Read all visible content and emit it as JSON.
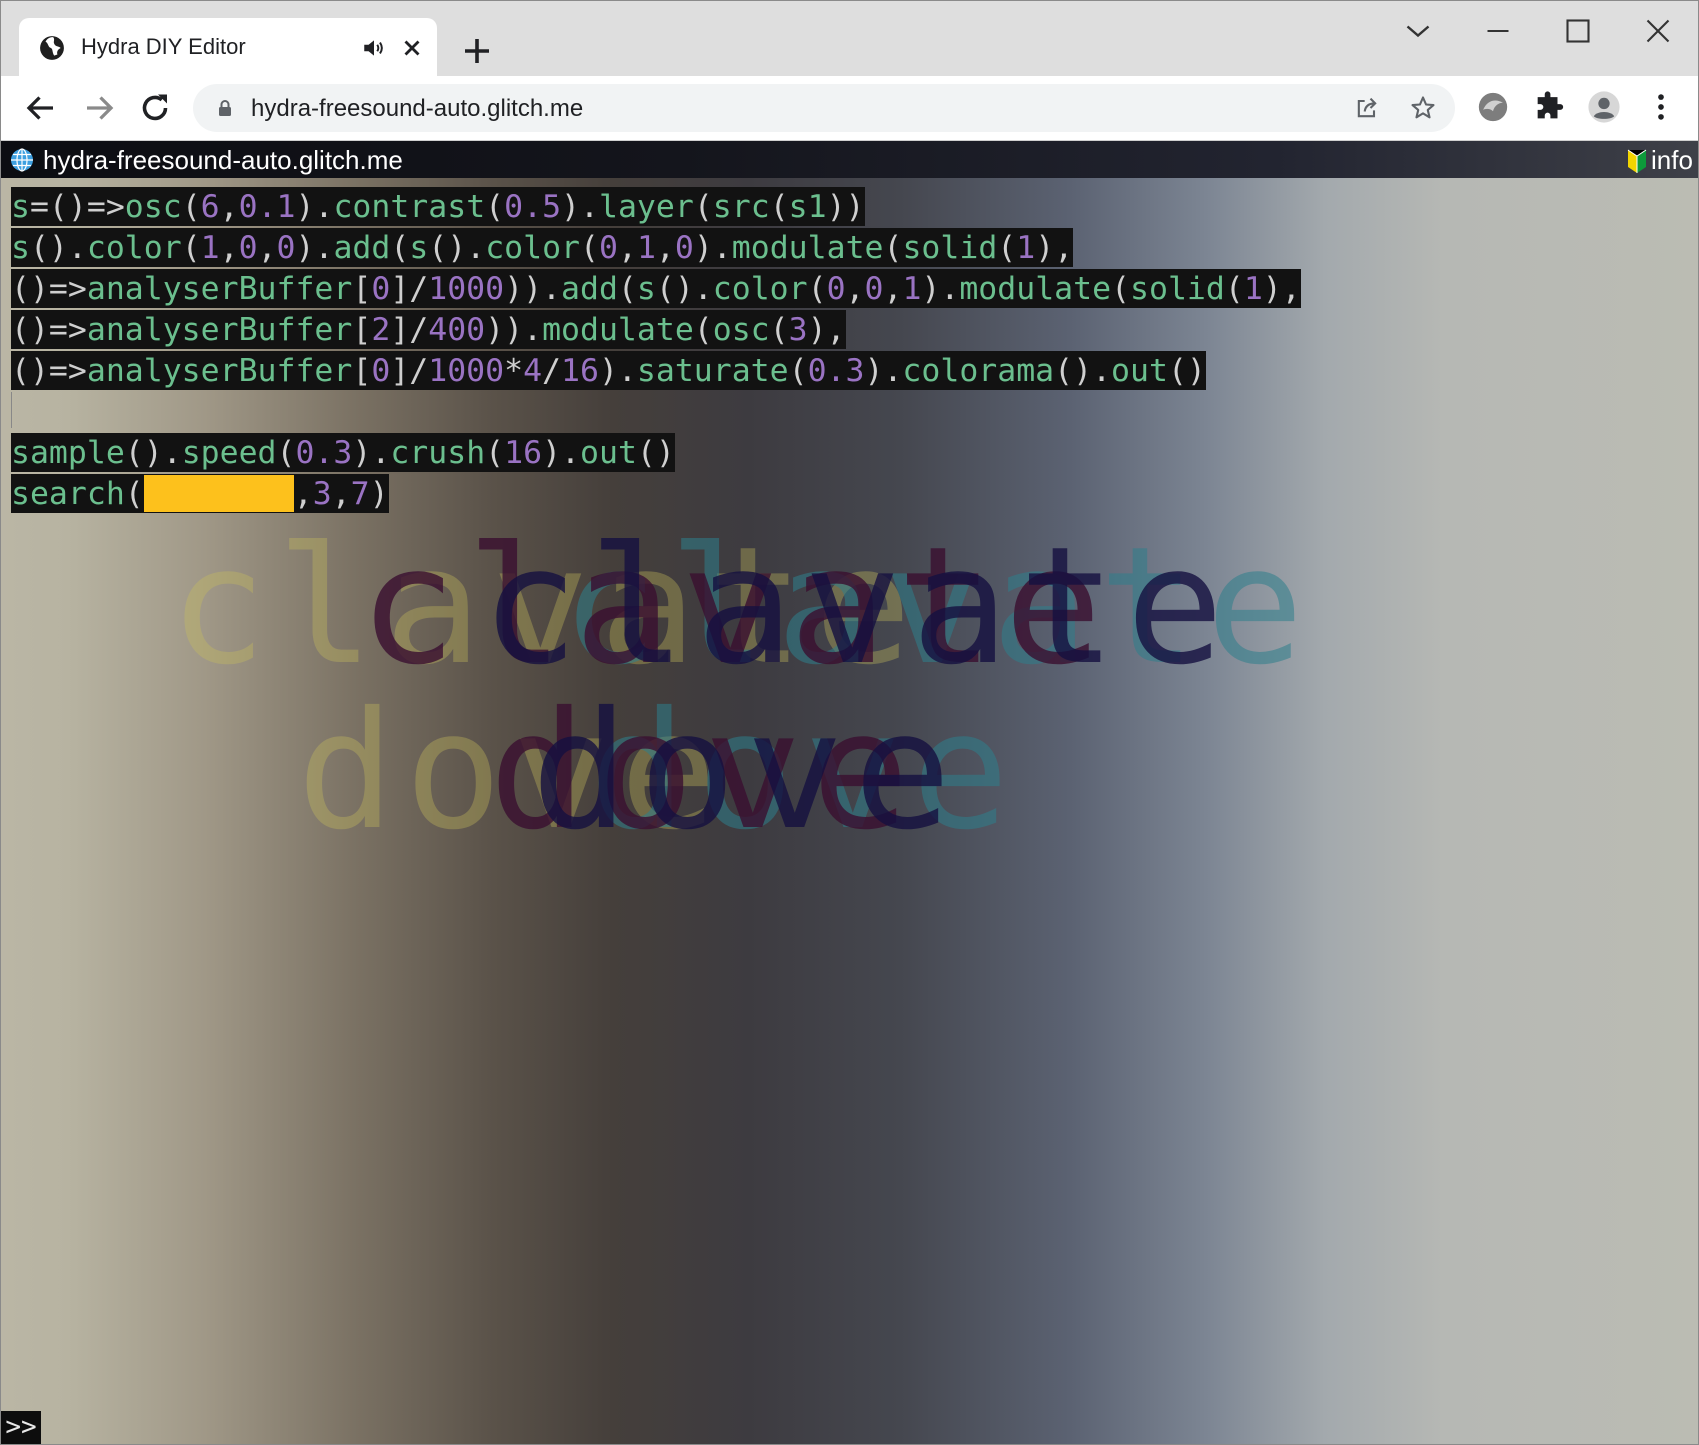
{
  "browser": {
    "tab": {
      "title": "Hydra DIY Editor"
    },
    "address": {
      "url": "hydra-freesound-auto.glitch.me"
    }
  },
  "page": {
    "header": {
      "site_name": "hydra-freesound-auto.glitch.me",
      "info_label": "info"
    },
    "code_lines": [
      [
        {
          "t": "s",
          "c": "fn"
        },
        {
          "t": "=()=>",
          "c": "pu"
        },
        {
          "t": "osc",
          "c": "fn"
        },
        {
          "t": "(",
          "c": "pu"
        },
        {
          "t": "6",
          "c": "num"
        },
        {
          "t": ",",
          "c": "pu"
        },
        {
          "t": "0.1",
          "c": "num"
        },
        {
          "t": ").",
          "c": "pu"
        },
        {
          "t": "contrast",
          "c": "fn"
        },
        {
          "t": "(",
          "c": "pu"
        },
        {
          "t": "0.5",
          "c": "num"
        },
        {
          "t": ").",
          "c": "pu"
        },
        {
          "t": "layer",
          "c": "fn"
        },
        {
          "t": "(",
          "c": "pu"
        },
        {
          "t": "src",
          "c": "fn"
        },
        {
          "t": "(",
          "c": "pu"
        },
        {
          "t": "s1",
          "c": "fn"
        },
        {
          "t": "))",
          "c": "pu"
        }
      ],
      [
        {
          "t": "s",
          "c": "fn"
        },
        {
          "t": "().",
          "c": "pu"
        },
        {
          "t": "color",
          "c": "fn"
        },
        {
          "t": "(",
          "c": "pu"
        },
        {
          "t": "1",
          "c": "num"
        },
        {
          "t": ",",
          "c": "pu"
        },
        {
          "t": "0",
          "c": "num"
        },
        {
          "t": ",",
          "c": "pu"
        },
        {
          "t": "0",
          "c": "num"
        },
        {
          "t": ").",
          "c": "pu"
        },
        {
          "t": "add",
          "c": "fn"
        },
        {
          "t": "(",
          "c": "pu"
        },
        {
          "t": "s",
          "c": "fn"
        },
        {
          "t": "().",
          "c": "pu"
        },
        {
          "t": "color",
          "c": "fn"
        },
        {
          "t": "(",
          "c": "pu"
        },
        {
          "t": "0",
          "c": "num"
        },
        {
          "t": ",",
          "c": "pu"
        },
        {
          "t": "1",
          "c": "num"
        },
        {
          "t": ",",
          "c": "pu"
        },
        {
          "t": "0",
          "c": "num"
        },
        {
          "t": ").",
          "c": "pu"
        },
        {
          "t": "modulate",
          "c": "fn"
        },
        {
          "t": "(",
          "c": "pu"
        },
        {
          "t": "solid",
          "c": "fn"
        },
        {
          "t": "(",
          "c": "pu"
        },
        {
          "t": "1",
          "c": "num"
        },
        {
          "t": "),",
          "c": "pu"
        }
      ],
      [
        {
          "t": "()=>",
          "c": "pu"
        },
        {
          "t": "analyserBuffer",
          "c": "fn"
        },
        {
          "t": "[",
          "c": "pu"
        },
        {
          "t": "0",
          "c": "num"
        },
        {
          "t": "]/",
          "c": "pu"
        },
        {
          "t": "1000",
          "c": "num"
        },
        {
          "t": ")).",
          "c": "pu"
        },
        {
          "t": "add",
          "c": "fn"
        },
        {
          "t": "(",
          "c": "pu"
        },
        {
          "t": "s",
          "c": "fn"
        },
        {
          "t": "().",
          "c": "pu"
        },
        {
          "t": "color",
          "c": "fn"
        },
        {
          "t": "(",
          "c": "pu"
        },
        {
          "t": "0",
          "c": "num"
        },
        {
          "t": ",",
          "c": "pu"
        },
        {
          "t": "0",
          "c": "num"
        },
        {
          "t": ",",
          "c": "pu"
        },
        {
          "t": "1",
          "c": "num"
        },
        {
          "t": ").",
          "c": "pu"
        },
        {
          "t": "modulate",
          "c": "fn"
        },
        {
          "t": "(",
          "c": "pu"
        },
        {
          "t": "solid",
          "c": "fn"
        },
        {
          "t": "(",
          "c": "pu"
        },
        {
          "t": "1",
          "c": "num"
        },
        {
          "t": "),",
          "c": "pu"
        }
      ],
      [
        {
          "t": "()=>",
          "c": "pu"
        },
        {
          "t": "analyserBuffer",
          "c": "fn"
        },
        {
          "t": "[",
          "c": "pu"
        },
        {
          "t": "2",
          "c": "num"
        },
        {
          "t": "]/",
          "c": "pu"
        },
        {
          "t": "400",
          "c": "num"
        },
        {
          "t": ")).",
          "c": "pu"
        },
        {
          "t": "modulate",
          "c": "fn"
        },
        {
          "t": "(",
          "c": "pu"
        },
        {
          "t": "osc",
          "c": "fn"
        },
        {
          "t": "(",
          "c": "pu"
        },
        {
          "t": "3",
          "c": "num"
        },
        {
          "t": "),",
          "c": "pu"
        }
      ],
      [
        {
          "t": "()=>",
          "c": "pu"
        },
        {
          "t": "analyserBuffer",
          "c": "fn"
        },
        {
          "t": "[",
          "c": "pu"
        },
        {
          "t": "0",
          "c": "num"
        },
        {
          "t": "]/",
          "c": "pu"
        },
        {
          "t": "1000",
          "c": "num"
        },
        {
          "t": "*",
          "c": "pu"
        },
        {
          "t": "4",
          "c": "num"
        },
        {
          "t": "/",
          "c": "pu"
        },
        {
          "t": "16",
          "c": "num"
        },
        {
          "t": ").",
          "c": "pu"
        },
        {
          "t": "saturate",
          "c": "fn"
        },
        {
          "t": "(",
          "c": "pu"
        },
        {
          "t": "0.3",
          "c": "num"
        },
        {
          "t": ").",
          "c": "pu"
        },
        {
          "t": "colorama",
          "c": "fn"
        },
        {
          "t": "().",
          "c": "pu"
        },
        {
          "t": "out",
          "c": "fn"
        },
        {
          "t": "()",
          "c": "pu"
        }
      ],
      [],
      [
        {
          "t": "sample",
          "c": "fn"
        },
        {
          "t": "().",
          "c": "pu"
        },
        {
          "t": "speed",
          "c": "fn"
        },
        {
          "t": "(",
          "c": "pu"
        },
        {
          "t": "0.3",
          "c": "num"
        },
        {
          "t": ").",
          "c": "pu"
        },
        {
          "t": "crush",
          "c": "fn"
        },
        {
          "t": "(",
          "c": "pu"
        },
        {
          "t": "16",
          "c": "num"
        },
        {
          "t": ").",
          "c": "pu"
        },
        {
          "t": "out",
          "c": "fn"
        },
        {
          "t": "()",
          "c": "pu"
        }
      ],
      [
        {
          "t": "search",
          "c": "fn"
        },
        {
          "t": "(",
          "c": "pu"
        },
        {
          "t": "",
          "c": "yellow"
        },
        {
          "t": ",",
          "c": "pu"
        },
        {
          "t": "3",
          "c": "num"
        },
        {
          "t": ",",
          "c": "pu"
        },
        {
          "t": "7",
          "c": "num"
        },
        {
          "t": ")",
          "c": "pu"
        }
      ]
    ],
    "overlay_words": [
      {
        "text": "clavate",
        "color": "#c9bf5c",
        "opacity": 0.35
      },
      {
        "text": "clavate",
        "color": "#2e7f8c",
        "opacity": 0.55
      },
      {
        "text": "clavate",
        "color": "#3a0f30",
        "opacity": 0.8
      },
      {
        "text": "clavate",
        "color": "#151040",
        "opacity": 0.8
      },
      {
        "text": "dove",
        "color": "#c9bf5c",
        "opacity": 0.35
      },
      {
        "text": "dove",
        "color": "#2e7f8c",
        "opacity": 0.55
      },
      {
        "text": "dove",
        "color": "#3a0f30",
        "opacity": 0.8
      },
      {
        "text": "dove",
        "color": "#151040",
        "opacity": 0.8
      }
    ],
    "prompt_label": ">>"
  },
  "colors": {
    "code_function": "#6bbf8e",
    "code_number": "#9a73c3",
    "code_punct": "#cfcfcf",
    "highlight_yellow": "#fdc11c"
  },
  "icons": [
    "globe-icon",
    "audio-icon",
    "close-icon",
    "plus-icon",
    "chevron-down-icon",
    "minimize-icon",
    "maximize-icon",
    "window-close-icon",
    "back-icon",
    "forward-icon",
    "reload-icon",
    "lock-icon",
    "share-icon",
    "star-icon",
    "profile-sync-icon",
    "extensions-icon",
    "avatar-icon",
    "menu-icon",
    "beginner-icon"
  ]
}
